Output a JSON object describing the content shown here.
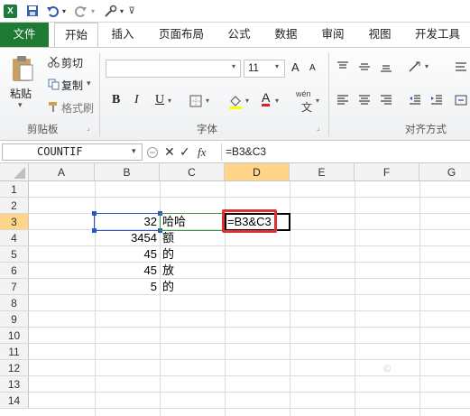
{
  "quick_access": {
    "app_icon": "X",
    "undo_icon": "undo-icon",
    "redo_icon": "redo-icon"
  },
  "tabs": [
    {
      "label": "文件"
    },
    {
      "label": "开始"
    },
    {
      "label": "插入"
    },
    {
      "label": "页面布局"
    },
    {
      "label": "公式"
    },
    {
      "label": "数据"
    },
    {
      "label": "审阅"
    },
    {
      "label": "视图"
    },
    {
      "label": "开发工具"
    }
  ],
  "ribbon": {
    "clipboard": {
      "paste": "粘贴",
      "cut": "剪切",
      "copy": "复制",
      "format_painter": "格式刷",
      "group": "剪贴板"
    },
    "font": {
      "font_name": "",
      "font_size": "11",
      "bold": "B",
      "italic": "I",
      "underline": "U",
      "grow": "A",
      "shrink": "A",
      "font_color": "A",
      "wen": "wén",
      "group": "字体"
    },
    "alignment": {
      "group": "对齐方式"
    }
  },
  "formula_bar": {
    "name_box": "COUNTIF",
    "fx": "fx",
    "cancel": "✕",
    "enter": "✓",
    "formula": "=B3&C3"
  },
  "grid": {
    "columns": [
      "A",
      "B",
      "C",
      "D",
      "E",
      "F",
      "G"
    ],
    "rows": [
      "1",
      "2",
      "3",
      "4",
      "5",
      "6",
      "7",
      "8",
      "9",
      "10",
      "11",
      "12",
      "13",
      "14"
    ],
    "B3": "32",
    "C3": "哈哈",
    "B4": "3454",
    "C4": "额",
    "B5": "45",
    "C5": "的",
    "B6": "45",
    "C6": "放",
    "B7": "5",
    "C7": "的",
    "D3": "=B3&C3"
  },
  "colors": {
    "file_tab": "#1f7a34",
    "selection_header": "#ffd58a",
    "highlight_box": "#e0302f",
    "ref_b3": "#2b56c8",
    "ref_c3": "#3a9a3a"
  }
}
